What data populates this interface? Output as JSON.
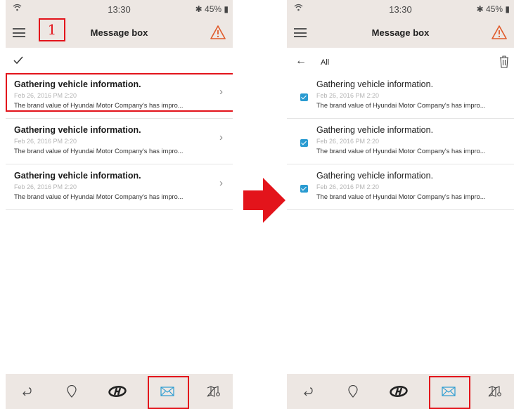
{
  "status_bar": {
    "time": "13:30",
    "battery": "45%"
  },
  "app_bar": {
    "title": "Message box"
  },
  "annotation": {
    "step_number": "1"
  },
  "selection_toolbar": {
    "all_label": "All"
  },
  "messages": [
    {
      "title": "Gathering vehicle information.",
      "date": "Feb 26, 2016 PM 2:20",
      "preview": "The brand value of Hyundai Motor Company's has impro..."
    },
    {
      "title": "Gathering vehicle information.",
      "date": "Feb 26, 2016 PM 2:20",
      "preview": "The brand value of Hyundai Motor Company's has impro..."
    },
    {
      "title": "Gathering vehicle information.",
      "date": "Feb 26, 2016 PM 2:20",
      "preview": "The brand value of Hyundai Motor Company's has impro..."
    }
  ],
  "bottom_nav": [
    "return-icon",
    "location-pin-icon",
    "hyundai-logo-icon",
    "mail-icon",
    "map-icon"
  ],
  "colors": {
    "header_bg": "#ede7e3",
    "highlight": "#e3141b",
    "checkbox": "#2a9bd1",
    "warning": "#e05a2a"
  }
}
